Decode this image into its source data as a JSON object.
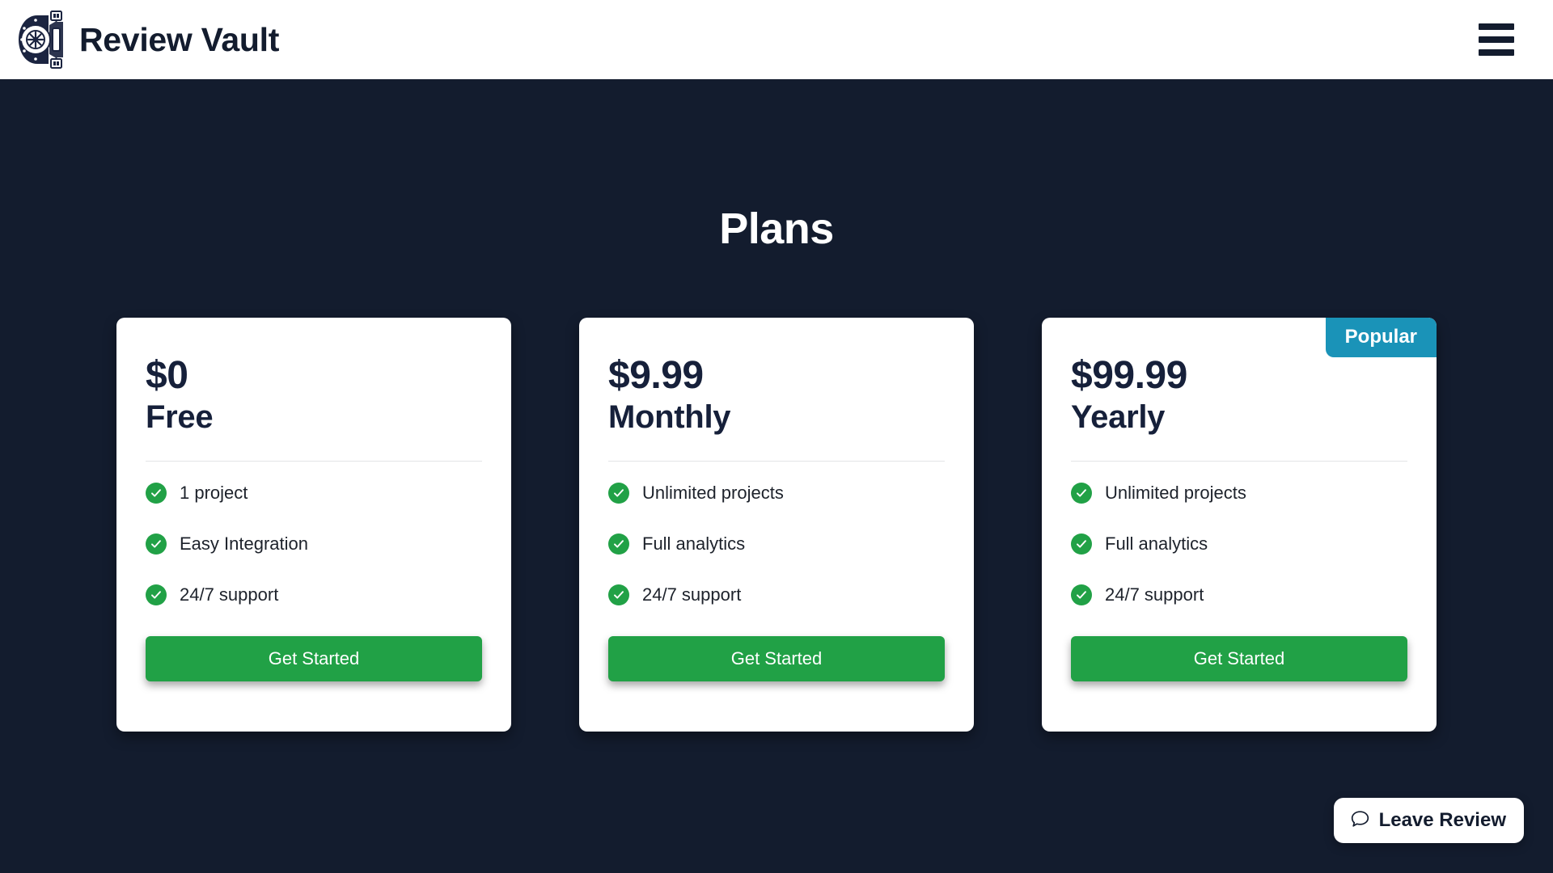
{
  "header": {
    "logo_icon": "vault-door-icon",
    "brand_title": "Review Vault",
    "menu_icon": "hamburger-menu-icon"
  },
  "main": {
    "title": "Plans",
    "plans": [
      {
        "price": "$0",
        "name": "Free",
        "features": [
          "1 project",
          "Easy Integration",
          "24/7 support"
        ],
        "cta_label": "Get Started",
        "badge": null
      },
      {
        "price": "$9.99",
        "name": "Monthly",
        "features": [
          "Unlimited projects",
          "Full analytics",
          "24/7 support"
        ],
        "cta_label": "Get Started",
        "badge": null
      },
      {
        "price": "$99.99",
        "name": "Yearly",
        "features": [
          "Unlimited projects",
          "Full analytics",
          "24/7 support"
        ],
        "cta_label": "Get Started",
        "badge": "Popular"
      }
    ]
  },
  "review_widget": {
    "icon": "speech-bubble-icon",
    "label": "Leave Review"
  },
  "colors": {
    "page_background": "#131c2e",
    "header_background": "#ffffff",
    "card_background": "#ffffff",
    "accent_green": "#21a146",
    "badge_teal": "#1a93b8",
    "text_dark": "#16203a",
    "text_light": "#ffffff"
  }
}
